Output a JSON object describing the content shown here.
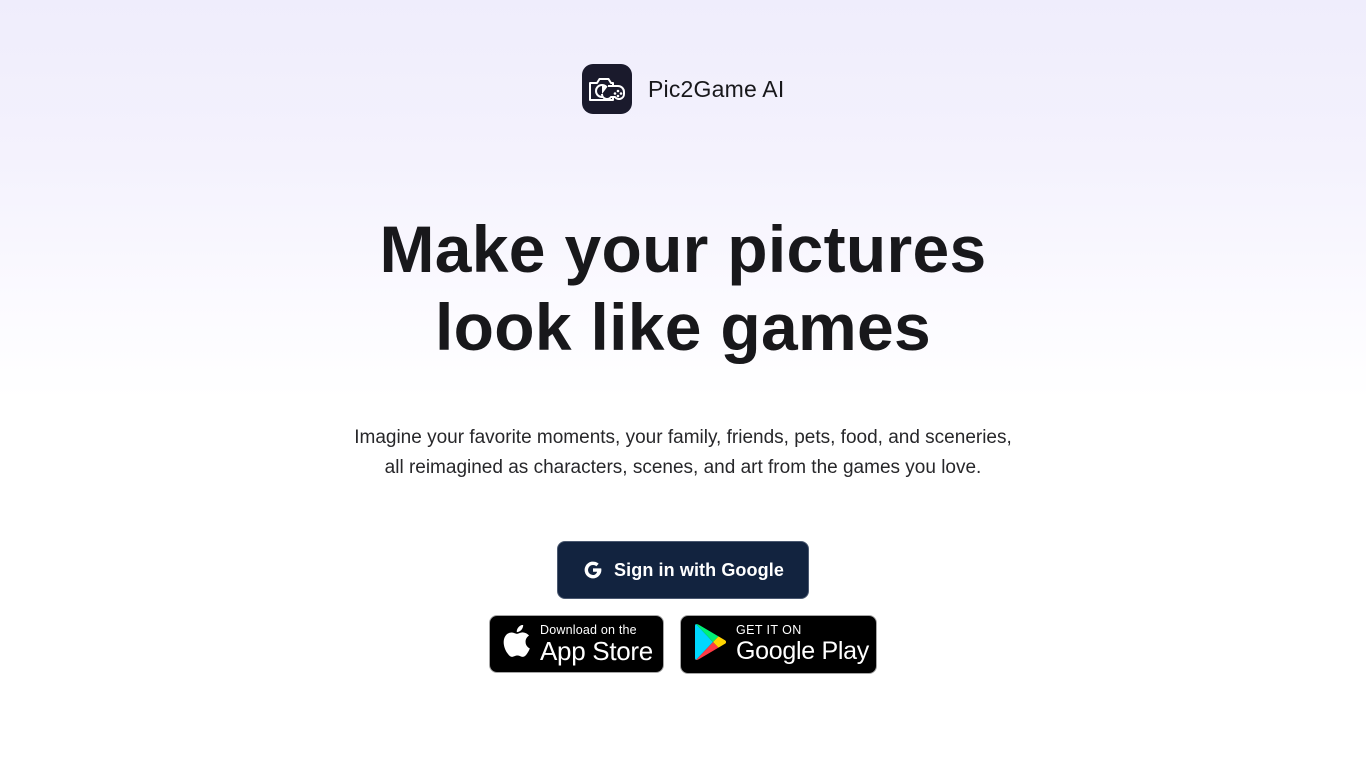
{
  "brand": {
    "name": "Pic2Game AI",
    "logo_icon": "camera-gamepad-icon",
    "logo_bg": "#1a1a2c"
  },
  "hero": {
    "headline_line1": "Make your pictures",
    "headline_line2": "look like games",
    "subtitle_line1": "Imagine your favorite moments, your family, friends, pets, food, and sceneries,",
    "subtitle_line2": "all reimagined as characters, scenes, and art from the games you love."
  },
  "actions": {
    "google_signin": {
      "label": "Sign in with Google",
      "icon": "google-g-icon",
      "bg": "#12233f"
    },
    "app_store": {
      "small": "Download on the",
      "big": "App Store",
      "icon": "apple-icon"
    },
    "google_play": {
      "small": "GET IT ON",
      "big": "Google Play",
      "icon": "google-play-icon"
    }
  },
  "colors": {
    "text": "#18181b",
    "bg_top": "#efedfc",
    "bg_bottom": "#ffffff"
  }
}
